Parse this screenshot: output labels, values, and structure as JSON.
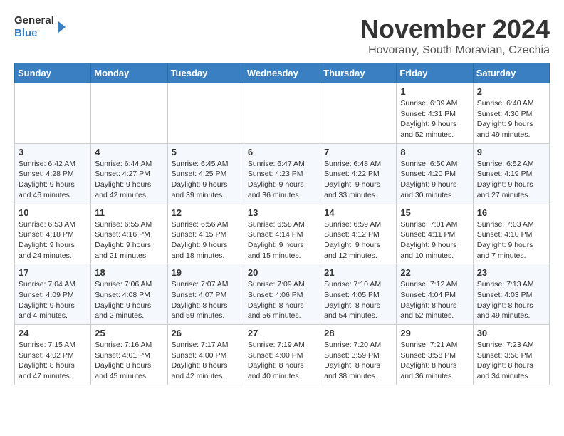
{
  "logo": {
    "line1": "General",
    "line2": "Blue"
  },
  "title": "November 2024",
  "location": "Hovorany, South Moravian, Czechia",
  "weekdays": [
    "Sunday",
    "Monday",
    "Tuesday",
    "Wednesday",
    "Thursday",
    "Friday",
    "Saturday"
  ],
  "weeks": [
    [
      {
        "day": "",
        "info": ""
      },
      {
        "day": "",
        "info": ""
      },
      {
        "day": "",
        "info": ""
      },
      {
        "day": "",
        "info": ""
      },
      {
        "day": "",
        "info": ""
      },
      {
        "day": "1",
        "info": "Sunrise: 6:39 AM\nSunset: 4:31 PM\nDaylight: 9 hours\nand 52 minutes."
      },
      {
        "day": "2",
        "info": "Sunrise: 6:40 AM\nSunset: 4:30 PM\nDaylight: 9 hours\nand 49 minutes."
      }
    ],
    [
      {
        "day": "3",
        "info": "Sunrise: 6:42 AM\nSunset: 4:28 PM\nDaylight: 9 hours\nand 46 minutes."
      },
      {
        "day": "4",
        "info": "Sunrise: 6:44 AM\nSunset: 4:27 PM\nDaylight: 9 hours\nand 42 minutes."
      },
      {
        "day": "5",
        "info": "Sunrise: 6:45 AM\nSunset: 4:25 PM\nDaylight: 9 hours\nand 39 minutes."
      },
      {
        "day": "6",
        "info": "Sunrise: 6:47 AM\nSunset: 4:23 PM\nDaylight: 9 hours\nand 36 minutes."
      },
      {
        "day": "7",
        "info": "Sunrise: 6:48 AM\nSunset: 4:22 PM\nDaylight: 9 hours\nand 33 minutes."
      },
      {
        "day": "8",
        "info": "Sunrise: 6:50 AM\nSunset: 4:20 PM\nDaylight: 9 hours\nand 30 minutes."
      },
      {
        "day": "9",
        "info": "Sunrise: 6:52 AM\nSunset: 4:19 PM\nDaylight: 9 hours\nand 27 minutes."
      }
    ],
    [
      {
        "day": "10",
        "info": "Sunrise: 6:53 AM\nSunset: 4:18 PM\nDaylight: 9 hours\nand 24 minutes."
      },
      {
        "day": "11",
        "info": "Sunrise: 6:55 AM\nSunset: 4:16 PM\nDaylight: 9 hours\nand 21 minutes."
      },
      {
        "day": "12",
        "info": "Sunrise: 6:56 AM\nSunset: 4:15 PM\nDaylight: 9 hours\nand 18 minutes."
      },
      {
        "day": "13",
        "info": "Sunrise: 6:58 AM\nSunset: 4:14 PM\nDaylight: 9 hours\nand 15 minutes."
      },
      {
        "day": "14",
        "info": "Sunrise: 6:59 AM\nSunset: 4:12 PM\nDaylight: 9 hours\nand 12 minutes."
      },
      {
        "day": "15",
        "info": "Sunrise: 7:01 AM\nSunset: 4:11 PM\nDaylight: 9 hours\nand 10 minutes."
      },
      {
        "day": "16",
        "info": "Sunrise: 7:03 AM\nSunset: 4:10 PM\nDaylight: 9 hours\nand 7 minutes."
      }
    ],
    [
      {
        "day": "17",
        "info": "Sunrise: 7:04 AM\nSunset: 4:09 PM\nDaylight: 9 hours\nand 4 minutes."
      },
      {
        "day": "18",
        "info": "Sunrise: 7:06 AM\nSunset: 4:08 PM\nDaylight: 9 hours\nand 2 minutes."
      },
      {
        "day": "19",
        "info": "Sunrise: 7:07 AM\nSunset: 4:07 PM\nDaylight: 8 hours\nand 59 minutes."
      },
      {
        "day": "20",
        "info": "Sunrise: 7:09 AM\nSunset: 4:06 PM\nDaylight: 8 hours\nand 56 minutes."
      },
      {
        "day": "21",
        "info": "Sunrise: 7:10 AM\nSunset: 4:05 PM\nDaylight: 8 hours\nand 54 minutes."
      },
      {
        "day": "22",
        "info": "Sunrise: 7:12 AM\nSunset: 4:04 PM\nDaylight: 8 hours\nand 52 minutes."
      },
      {
        "day": "23",
        "info": "Sunrise: 7:13 AM\nSunset: 4:03 PM\nDaylight: 8 hours\nand 49 minutes."
      }
    ],
    [
      {
        "day": "24",
        "info": "Sunrise: 7:15 AM\nSunset: 4:02 PM\nDaylight: 8 hours\nand 47 minutes."
      },
      {
        "day": "25",
        "info": "Sunrise: 7:16 AM\nSunset: 4:01 PM\nDaylight: 8 hours\nand 45 minutes."
      },
      {
        "day": "26",
        "info": "Sunrise: 7:17 AM\nSunset: 4:00 PM\nDaylight: 8 hours\nand 42 minutes."
      },
      {
        "day": "27",
        "info": "Sunrise: 7:19 AM\nSunset: 4:00 PM\nDaylight: 8 hours\nand 40 minutes."
      },
      {
        "day": "28",
        "info": "Sunrise: 7:20 AM\nSunset: 3:59 PM\nDaylight: 8 hours\nand 38 minutes."
      },
      {
        "day": "29",
        "info": "Sunrise: 7:21 AM\nSunset: 3:58 PM\nDaylight: 8 hours\nand 36 minutes."
      },
      {
        "day": "30",
        "info": "Sunrise: 7:23 AM\nSunset: 3:58 PM\nDaylight: 8 hours\nand 34 minutes."
      }
    ]
  ]
}
